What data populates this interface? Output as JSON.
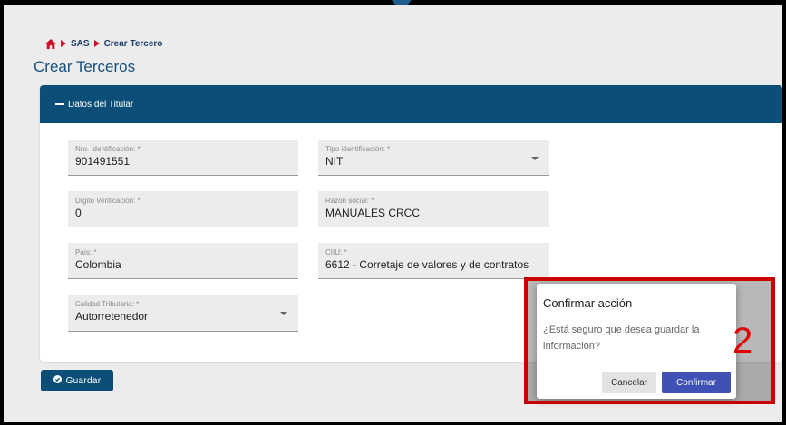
{
  "breadcrumb": {
    "items": [
      "SAS",
      "Crear Tercero"
    ]
  },
  "page": {
    "title": "Crear Terceros"
  },
  "section": {
    "header": "Datos del Titular"
  },
  "form": {
    "nro_identificacion": {
      "label": "Nro. Identificación: *",
      "value": "901491551"
    },
    "tipo_identificacion": {
      "label": "Tipo identificación: *",
      "value": "NIT"
    },
    "digito_verificacion": {
      "label": "Dígito Verificación: *",
      "value": "0"
    },
    "razon_social": {
      "label": "Razón social: *",
      "value": "MANUALES CRCC"
    },
    "pais": {
      "label": "País: *",
      "value": "Colombia"
    },
    "ciiu": {
      "label": "CIIU: *",
      "value": "6612 - Corretaje de valores y de contratos"
    },
    "calidad_tributaria": {
      "label": "Calidad Tributaria: *",
      "value": "Autorretenedor"
    }
  },
  "actions": {
    "save_label": "Guardar"
  },
  "dialog": {
    "title": "Confirmar acción",
    "message": "¿Está seguro que desea guardar la información?",
    "cancel_label": "Cancelar",
    "confirm_label": "Confirmar"
  },
  "annotation": {
    "step": "2"
  },
  "colors": {
    "primary": "#0b4f79",
    "confirm": "#3f51b5",
    "highlight": "#c80000"
  },
  "icons": [
    "home-icon",
    "chevron-right-icon",
    "minus-icon",
    "check-circle-icon",
    "chevron-down-icon"
  ]
}
